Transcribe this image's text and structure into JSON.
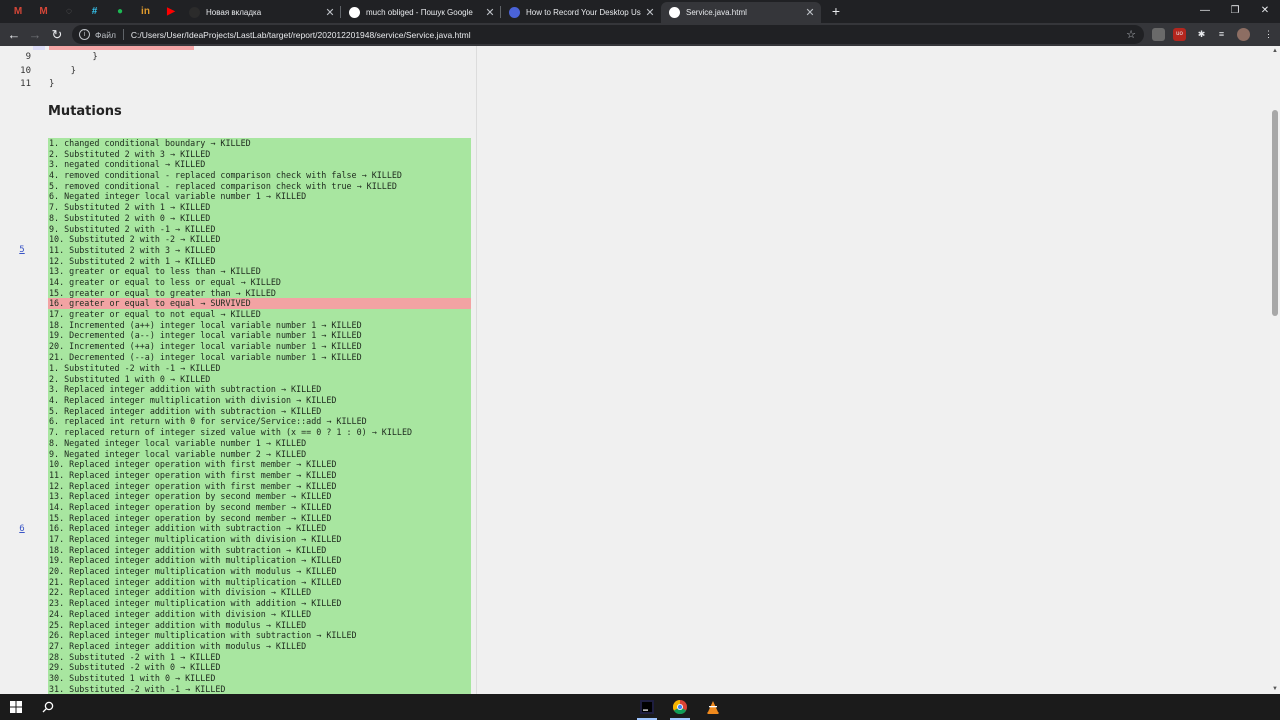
{
  "browser": {
    "pinned_tabs": [
      {
        "icon": "gmail-icon",
        "glyph": "M",
        "color": "#d44638"
      },
      {
        "icon": "gmail-icon",
        "glyph": "M",
        "color": "#d44638"
      },
      {
        "icon": "loading-icon",
        "glyph": "◌",
        "color": "#6b6b6b"
      },
      {
        "icon": "slack-icon",
        "glyph": "#",
        "color": "#36c5f0"
      },
      {
        "icon": "spotify-icon",
        "glyph": "●",
        "color": "#1db954"
      },
      {
        "icon": "linkedin-icon",
        "glyph": "in",
        "color": "#e09b2d"
      },
      {
        "icon": "youtube-icon",
        "glyph": "▶",
        "color": "#ff0000"
      }
    ],
    "tabs": [
      {
        "title": "Новая вкладка",
        "favicon_color": "#2b2b2b",
        "active": false
      },
      {
        "title": "much obliged - Пошук Google",
        "favicon_color": "#ffffff",
        "active": false
      },
      {
        "title": "How to Record Your Desktop Us",
        "favicon_color": "#4a63d8",
        "active": false
      },
      {
        "title": "Service.java.html",
        "favicon_color": "#ffffff",
        "active": true
      }
    ],
    "address": {
      "scheme_label": "Файл",
      "url": "C:/Users/User/IdeaProjects/LastLab/target/report/202012201948/service/Service.java.html"
    }
  },
  "code_lines": [
    {
      "num": "9",
      "text": "        }"
    },
    {
      "num": "10",
      "text": "    }"
    },
    {
      "num": "11",
      "text": "}"
    }
  ],
  "mutations_heading": "Mutations",
  "blocks": [
    {
      "line": "5",
      "items": [
        "1. changed conditional boundary → KILLED",
        "2. Substituted 2 with 3 → KILLED",
        "3. negated conditional → KILLED",
        "4. removed conditional - replaced comparison check with false → KILLED",
        "5. removed conditional - replaced comparison check with true → KILLED",
        "6. Negated integer local variable number 1 → KILLED",
        "7. Substituted 2 with 1 → KILLED",
        "8. Substituted 2 with 0 → KILLED",
        "9. Substituted 2 with -1 → KILLED",
        "10. Substituted 2 with -2 → KILLED",
        "11. Substituted 2 with 3 → KILLED",
        "12. Substituted 2 with 1 → KILLED",
        "13. greater or equal to less than → KILLED",
        "14. greater or equal to less or equal → KILLED",
        "15. greater or equal to greater than → KILLED",
        "16. greater or equal to equal → SURVIVED",
        "17. greater or equal to not equal → KILLED",
        "18. Incremented (a++) integer local variable number 1 → KILLED",
        "19. Decremented (a--) integer local variable number 1 → KILLED",
        "20. Incremented (++a) integer local variable number 1 → KILLED",
        "21. Decremented (--a) integer local variable number 1 → KILLED"
      ],
      "survived_index": 15
    },
    {
      "line": "6",
      "items": [
        "1. Substituted -2 with -1 → KILLED",
        "2. Substituted 1 with 0 → KILLED",
        "3. Replaced integer addition with subtraction → KILLED",
        "4. Replaced integer multiplication with division → KILLED",
        "5. Replaced integer addition with subtraction → KILLED",
        "6. replaced int return with 0 for service/Service::add → KILLED",
        "7. replaced return of integer sized value with (x == 0 ? 1 : 0) → KILLED",
        "8. Negated integer local variable number 1 → KILLED",
        "9. Negated integer local variable number 2 → KILLED",
        "10. Replaced integer operation with first member → KILLED",
        "11. Replaced integer operation with first member → KILLED",
        "12. Replaced integer operation with first member → KILLED",
        "13. Replaced integer operation by second member → KILLED",
        "14. Replaced integer operation by second member → KILLED",
        "15. Replaced integer operation by second member → KILLED",
        "16. Replaced integer addition with subtraction → KILLED",
        "17. Replaced integer multiplication with division → KILLED",
        "18. Replaced integer addition with subtraction → KILLED",
        "19. Replaced integer addition with multiplication → KILLED",
        "20. Replaced integer multiplication with modulus → KILLED",
        "21. Replaced integer addition with multiplication → KILLED",
        "22. Replaced integer addition with division → KILLED",
        "23. Replaced integer multiplication with addition → KILLED",
        "24. Replaced integer addition with division → KILLED",
        "25. Replaced integer addition with modulus → KILLED",
        "26. Replaced integer multiplication with subtraction → KILLED",
        "27. Replaced integer addition with modulus → KILLED",
        "28. Substituted -2 with 1 → KILLED",
        "29. Substituted -2 with 0 → KILLED",
        "30. Substituted 1 with 0 → KILLED",
        "31. Substituted -2 with -1 → KILLED"
      ],
      "survived_index": -1
    }
  ],
  "colors": {
    "killed_bg": "#a8e6a0",
    "survived_bg": "#f2a3a3"
  },
  "taskbar": {
    "icons": [
      "windows-start-icon",
      "search-icon",
      "intellij-icon",
      "chrome-icon",
      "vlc-icon"
    ]
  }
}
